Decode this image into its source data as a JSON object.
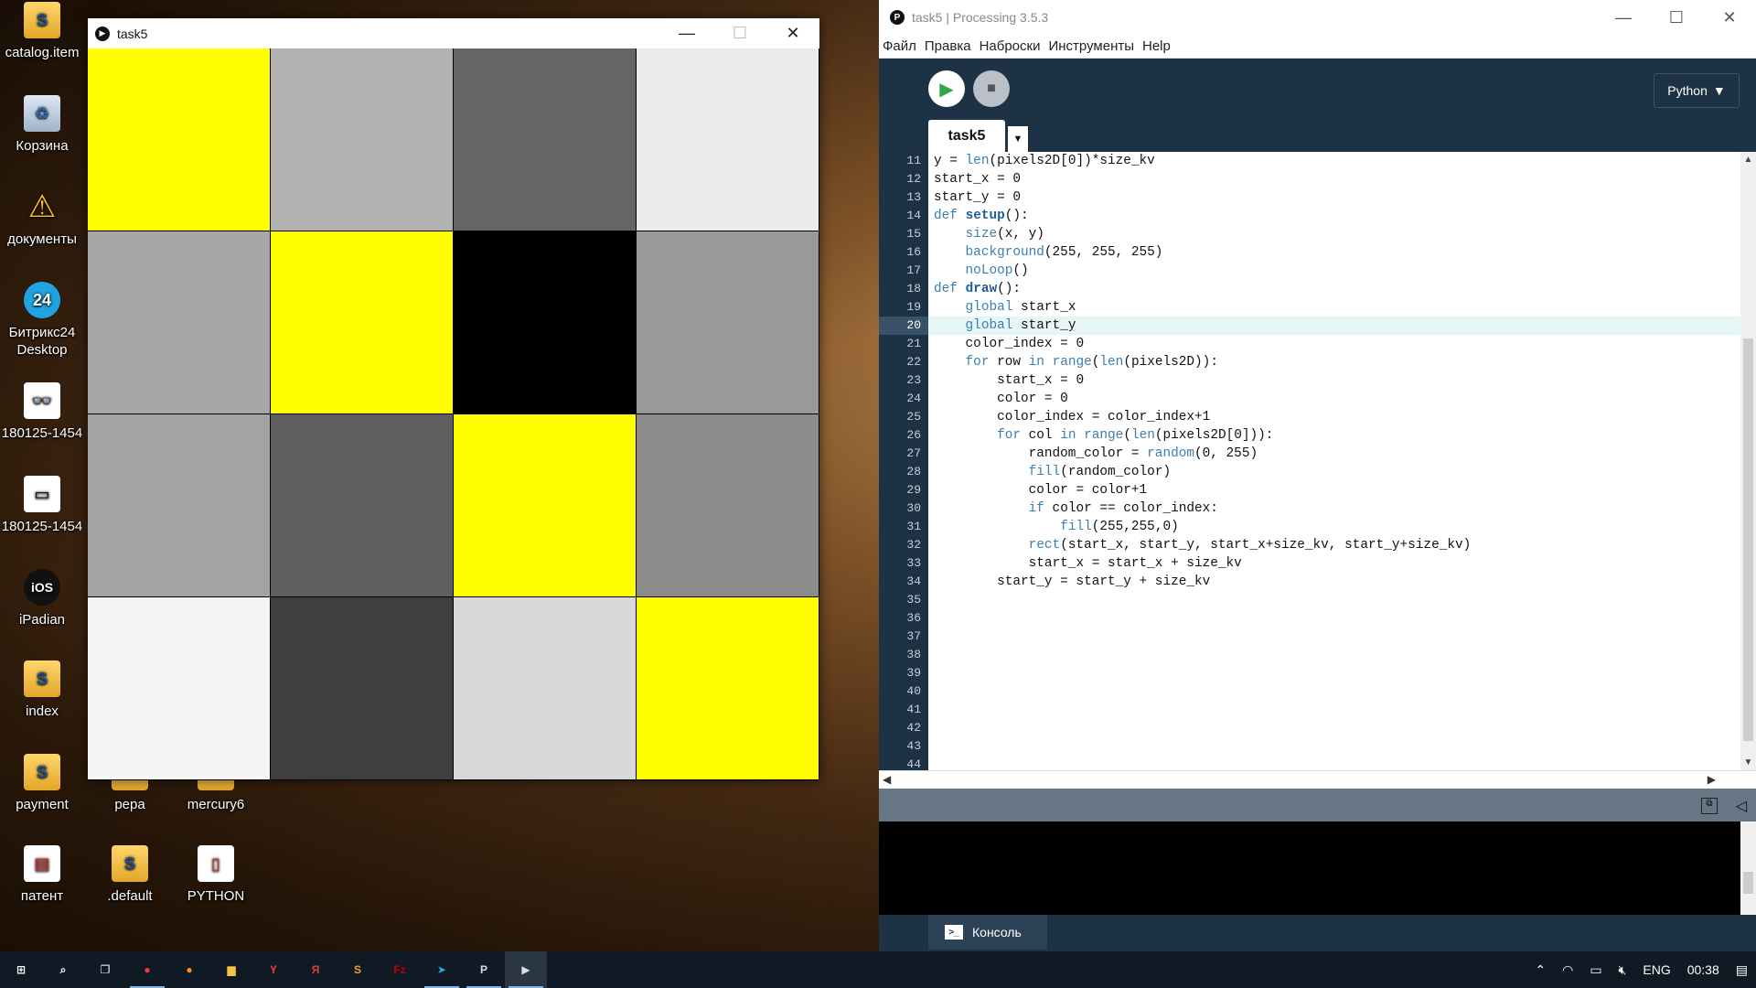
{
  "desktop": {
    "icons": [
      {
        "label": "catalog.item",
        "glyph": "S",
        "icon": "sublime-file-icon"
      },
      {
        "label": "Корзина",
        "glyph": "♻",
        "icon": "recycle-bin-icon"
      },
      {
        "label": "документы",
        "glyph": "⚠",
        "icon": "warning-folder-icon"
      },
      {
        "label": "Битрикс24 Desktop",
        "glyph": "24",
        "icon": "bitrix24-icon"
      },
      {
        "label": "180125-1454",
        "glyph": "👓",
        "icon": "glasses-file-icon"
      },
      {
        "label": "180125-1454",
        "glyph": "▭",
        "icon": "glasses-file-icon"
      },
      {
        "label": "iPadian",
        "glyph": "iOS",
        "icon": "ipadian-icon"
      },
      {
        "label": "index",
        "glyph": "S",
        "icon": "sublime-file-icon"
      },
      {
        "label": "payment",
        "glyph": "S",
        "icon": "sublime-file-icon"
      },
      {
        "label": "pepa",
        "glyph": "",
        "icon": "folder-icon"
      },
      {
        "label": "mercury6",
        "glyph": "",
        "icon": "folder-icon"
      },
      {
        "label": "патент",
        "glyph": "▤",
        "icon": "document-icon"
      },
      {
        "label": ".default",
        "glyph": "S",
        "icon": "sublime-file-icon"
      },
      {
        "label": "PYTHON",
        "glyph": "▯",
        "icon": "document-icon"
      }
    ]
  },
  "sketch_window": {
    "title": "task5",
    "minimize": "—",
    "maximize": "☐",
    "close": "✕",
    "grid": [
      [
        "#ffff00",
        "#b2b2b2",
        "#656565",
        "#ebebeb"
      ],
      [
        "#a7a7a7",
        "#ffff00",
        "#000000",
        "#999999"
      ],
      [
        "#a3a3a3",
        "#5e5e5e",
        "#ffff00",
        "#8c8c8c"
      ],
      [
        "#f5f5f5",
        "#3f3f3f",
        "#d8d8d8",
        "#ffff00"
      ]
    ]
  },
  "ide": {
    "title": "task5 | Processing 3.5.3",
    "menu": [
      "Файл",
      "Правка",
      "Наброски",
      "Инструменты",
      "Help"
    ],
    "mode": "Python",
    "tab": "task5",
    "console_tab": "Консоль",
    "highlight_line": 20,
    "code": [
      {
        "n": 11,
        "t": "y = len(pixels2D[0])*size_kv"
      },
      {
        "n": 12,
        "t": "start_x = 0"
      },
      {
        "n": 13,
        "t": "start_y = 0"
      },
      {
        "n": 14,
        "t": "def setup():"
      },
      {
        "n": 15,
        "t": "    size(x, y)"
      },
      {
        "n": 16,
        "t": "    background(255, 255, 255)"
      },
      {
        "n": 17,
        "t": "    noLoop()"
      },
      {
        "n": 18,
        "t": "def draw():"
      },
      {
        "n": 19,
        "t": "    global start_x"
      },
      {
        "n": 20,
        "t": "    global start_y"
      },
      {
        "n": 21,
        "t": "    color_index = 0"
      },
      {
        "n": 22,
        "t": "    for row in range(len(pixels2D)):"
      },
      {
        "n": 23,
        "t": "        start_x = 0"
      },
      {
        "n": 24,
        "t": "        color = 0"
      },
      {
        "n": 25,
        "t": "        color_index = color_index+1"
      },
      {
        "n": 26,
        "t": "        for col in range(len(pixels2D[0])):"
      },
      {
        "n": 27,
        "t": "            random_color = random(0, 255)"
      },
      {
        "n": 28,
        "t": "            fill(random_color)"
      },
      {
        "n": 29,
        "t": "            color = color+1"
      },
      {
        "n": 30,
        "t": "            if color == color_index:"
      },
      {
        "n": 31,
        "t": "                fill(255,255,0)"
      },
      {
        "n": 32,
        "t": "            rect(start_x, start_y, start_x+size_kv, start_y+size_kv)"
      },
      {
        "n": 33,
        "t": "            start_x = start_x + size_kv"
      },
      {
        "n": 34,
        "t": "        start_y = start_y + size_kv"
      },
      {
        "n": 35,
        "t": ""
      },
      {
        "n": 36,
        "t": ""
      },
      {
        "n": 37,
        "t": ""
      },
      {
        "n": 38,
        "t": ""
      },
      {
        "n": 39,
        "t": ""
      },
      {
        "n": 40,
        "t": ""
      },
      {
        "n": 41,
        "t": ""
      },
      {
        "n": 42,
        "t": ""
      },
      {
        "n": 43,
        "t": ""
      },
      {
        "n": 44,
        "t": ""
      }
    ]
  },
  "taskbar": {
    "apps": [
      {
        "name": "start-button",
        "glyph": "⊞",
        "color": "#ffffff"
      },
      {
        "name": "search-icon",
        "glyph": "⌕",
        "color": "#ffffff"
      },
      {
        "name": "task-view-icon",
        "glyph": "❐",
        "color": "#ffffff"
      },
      {
        "name": "chrome-icon",
        "glyph": "●",
        "color": "#e94235"
      },
      {
        "name": "firefox-icon",
        "glyph": "●",
        "color": "#ff8a1c"
      },
      {
        "name": "explorer-icon",
        "glyph": "▆",
        "color": "#f4c542"
      },
      {
        "name": "yandex-icon",
        "glyph": "Y",
        "color": "#ff3333"
      },
      {
        "name": "yandex-browser-icon",
        "glyph": "Я",
        "color": "#e23b3b"
      },
      {
        "name": "sublime-icon",
        "glyph": "S",
        "color": "#f59b2a"
      },
      {
        "name": "filezilla-icon",
        "glyph": "Fz",
        "color": "#bf0000"
      },
      {
        "name": "telegram-icon",
        "glyph": "➤",
        "color": "#2aa3e1"
      },
      {
        "name": "processing-icon",
        "glyph": "P",
        "color": "#dddddd"
      },
      {
        "name": "sketch-icon",
        "glyph": "▶",
        "color": "#dddddd"
      }
    ],
    "language": "ENG",
    "time": "00:38"
  }
}
